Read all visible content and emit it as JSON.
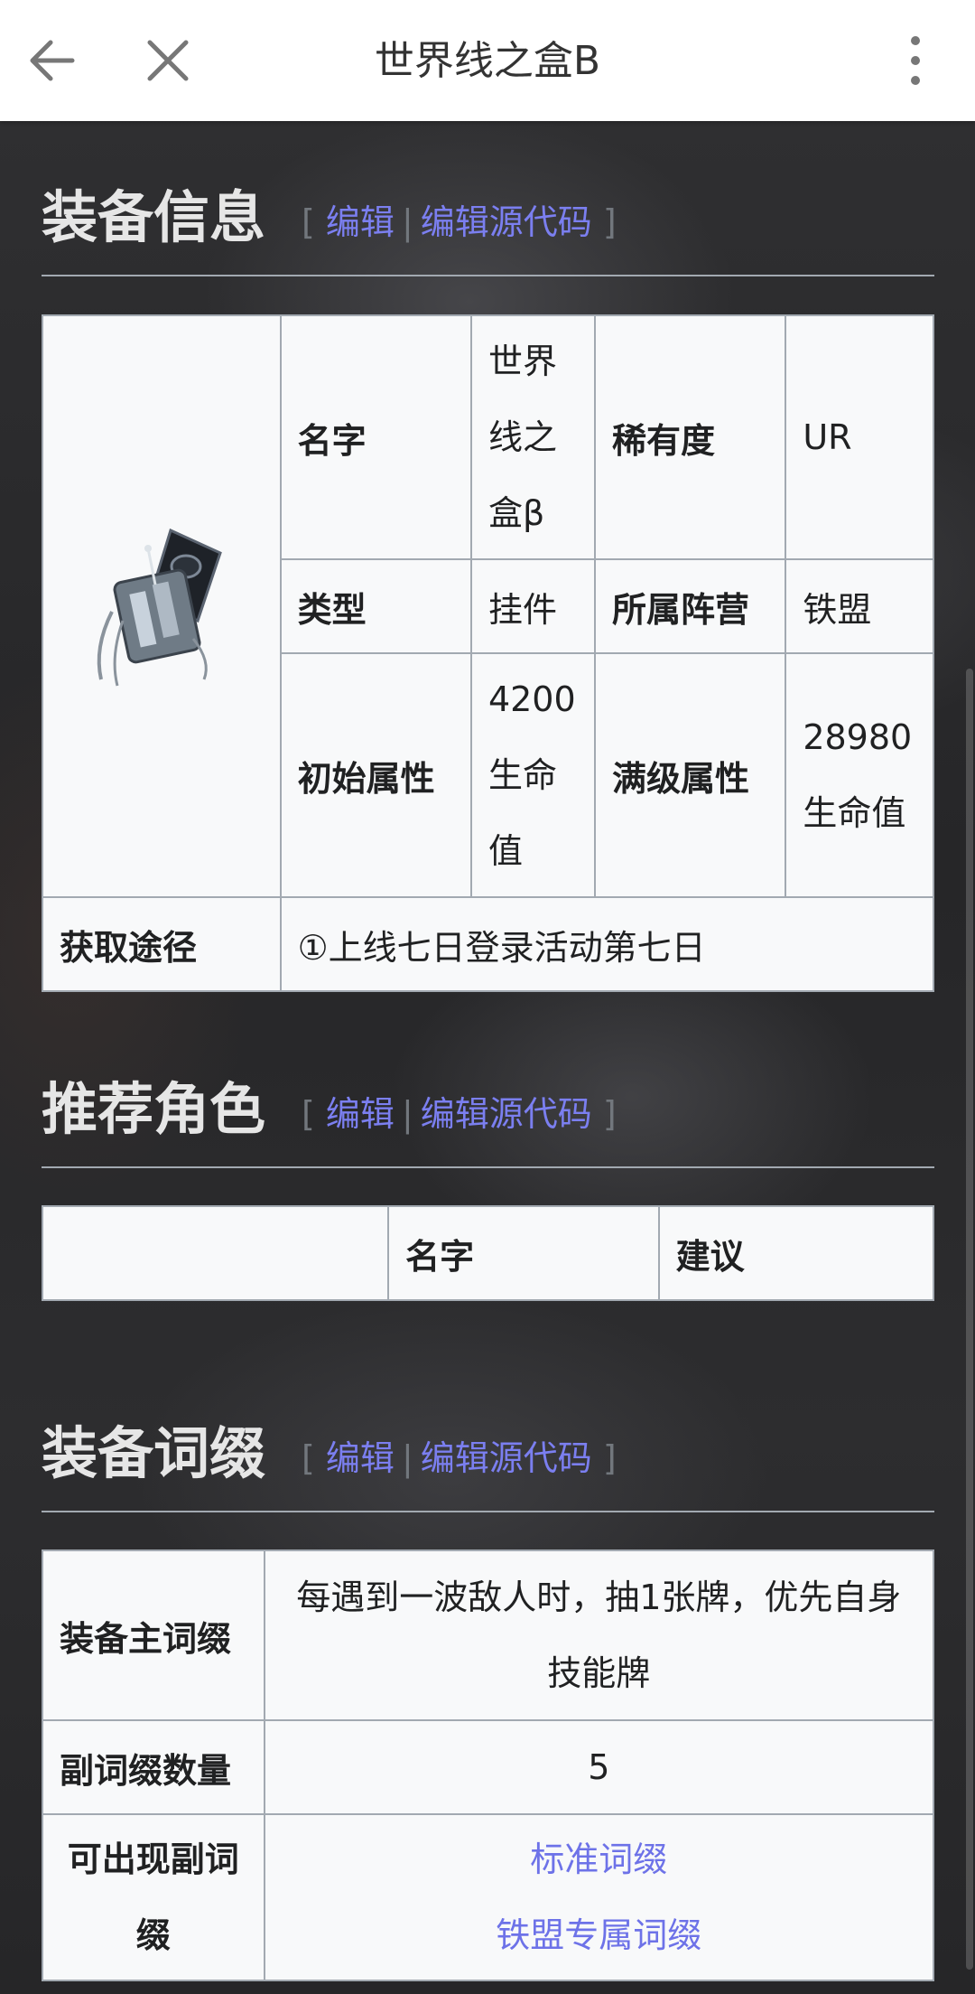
{
  "topbar": {
    "title": "世界线之盒B",
    "back_icon": "arrow-left-icon",
    "close_icon": "close-icon",
    "menu_icon": "more-vertical-icon"
  },
  "edit_links": {
    "open": "[",
    "edit": "编辑",
    "sep": "|",
    "edit_source": "编辑源代码",
    "close": "]"
  },
  "sections": {
    "info": {
      "heading": "装备信息",
      "name_label": "名字",
      "name_value": "世界线之盒β",
      "rarity_label": "稀有度",
      "rarity_value": "UR",
      "type_label": "类型",
      "type_value": "挂件",
      "faction_label": "所属阵营",
      "faction_value": "铁盟",
      "base_label": "初始属性",
      "base_value": "4200生命值",
      "max_label": "满级属性",
      "max_value": "28980生命值",
      "source_label": "获取途径",
      "source_value": "①上线七日登录活动第七日"
    },
    "recommend": {
      "heading": "推荐角色",
      "col_name": "名字",
      "col_advice": "建议"
    },
    "affix": {
      "heading": "装备词缀",
      "main_label": "装备主词缀",
      "main_value": "每遇到一波敌人时，抽1张牌，优先自身技能牌",
      "sub_count_label": "副词缀数量",
      "sub_count_value": "5",
      "sub_avail_label": "可出现副词缀",
      "sub_link1": "标准词缀",
      "sub_link2": "铁盟专属词缀"
    }
  },
  "colors": {
    "link": "#7b7ff0",
    "heading": "#e6e6e6",
    "table_bg": "#f8f9fa",
    "border": "#a2a9b1"
  }
}
